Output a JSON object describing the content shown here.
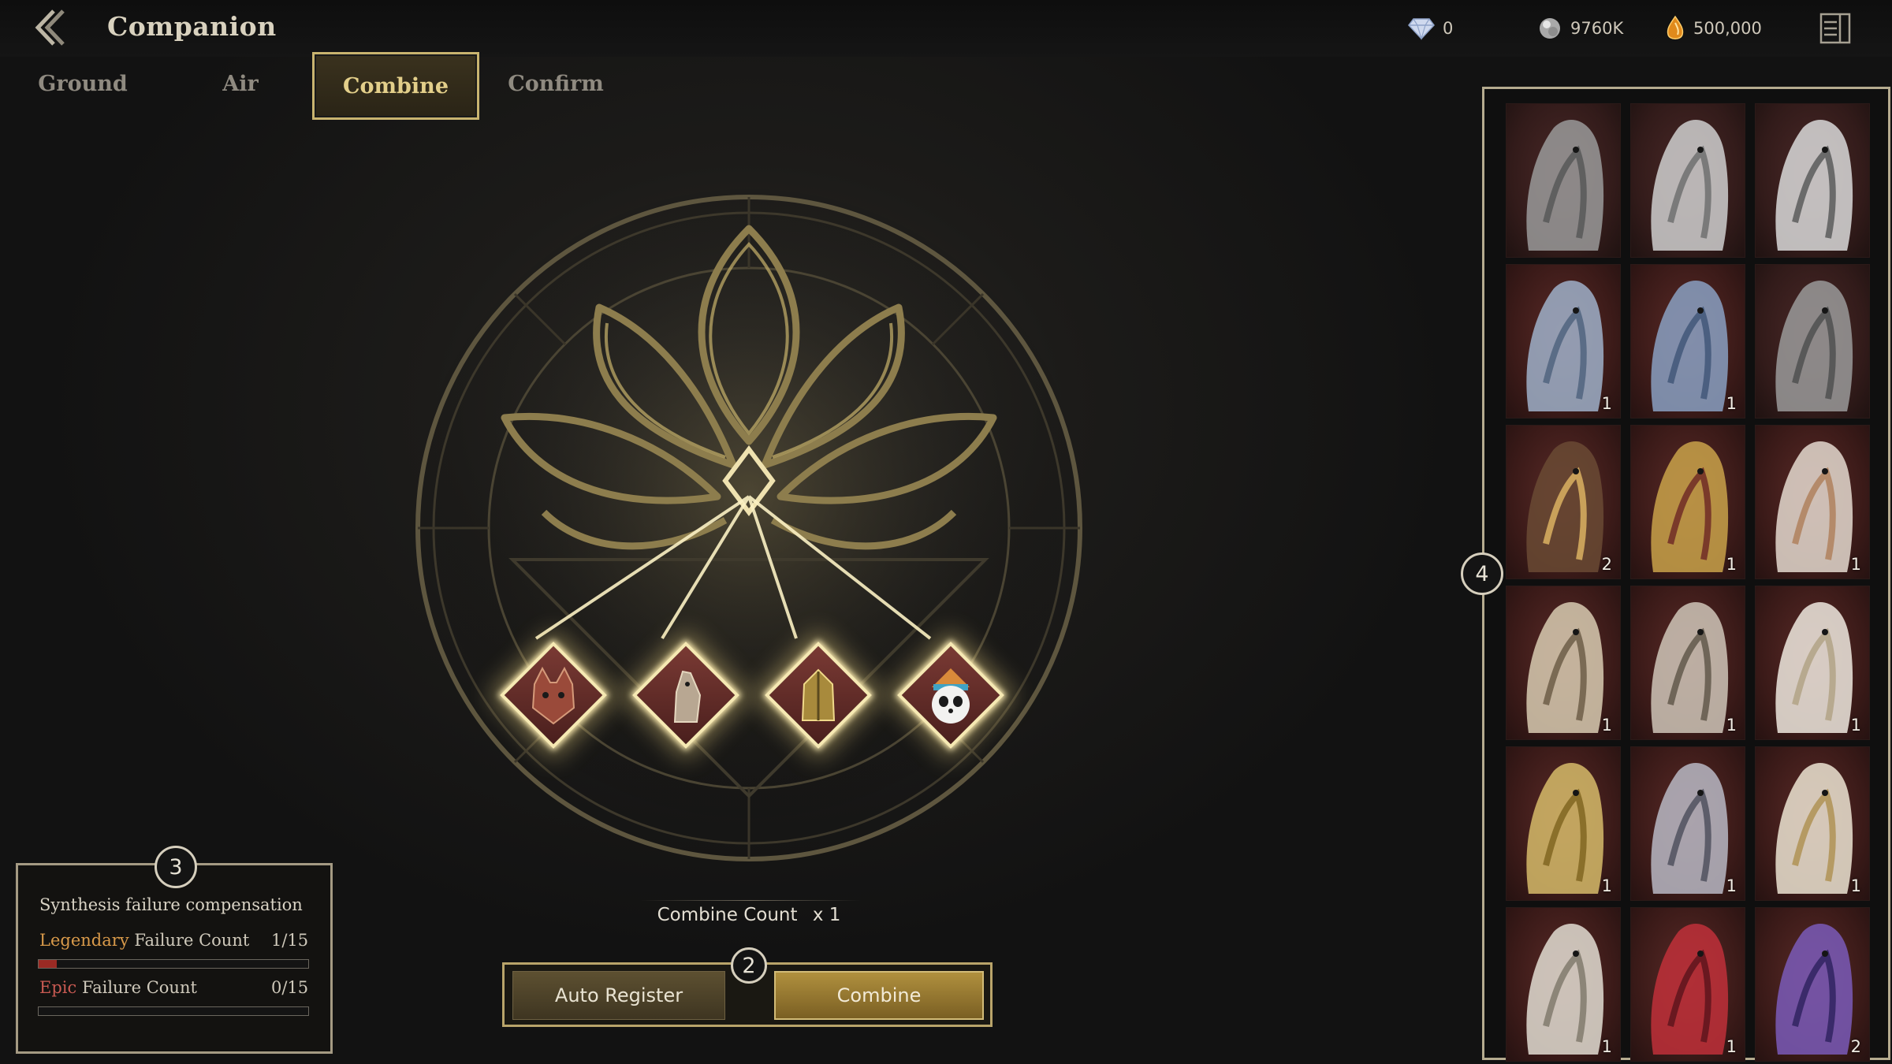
{
  "header": {
    "title": "Companion",
    "currencies": [
      {
        "icon": "diamond-icon",
        "value": "0"
      },
      {
        "icon": "silver-orb-icon",
        "value": "9760K"
      },
      {
        "icon": "amber-gem-icon",
        "value": "500,000"
      }
    ]
  },
  "tabs": [
    {
      "label": "Ground",
      "active": false
    },
    {
      "label": "Air",
      "active": false
    },
    {
      "label": "Combine",
      "active": true
    },
    {
      "label": "Confirm",
      "active": false
    }
  ],
  "combine": {
    "slots": [
      {
        "icon": "wolf-portrait-icon"
      },
      {
        "icon": "horse-portrait-icon"
      },
      {
        "icon": "armored-beast-portrait-icon"
      },
      {
        "icon": "panda-portrait-icon"
      }
    ],
    "count_label": "Combine Count",
    "count_value": "x 1",
    "auto_register_label": "Auto Register",
    "combine_label": "Combine"
  },
  "badges": {
    "buttons": "2",
    "failure": "3",
    "inventory": "4"
  },
  "failure_panel": {
    "title": "Synthesis failure compensation",
    "rows": [
      {
        "rarity": "Legendary",
        "label": "Failure Count",
        "value": "1/15",
        "progress": 0.067
      },
      {
        "rarity": "Epic",
        "label": "Failure Count",
        "value": "0/15",
        "progress": 0
      }
    ]
  },
  "inventory": [
    {
      "name": "armored-beast",
      "qty": "",
      "tone": "grey"
    },
    {
      "name": "white-horse",
      "qty": "",
      "tone": "grey"
    },
    {
      "name": "panda",
      "qty": "",
      "tone": "grey"
    },
    {
      "name": "armored-war-beast",
      "qty": "1",
      "tone": "color"
    },
    {
      "name": "blue-wolf",
      "qty": "1",
      "tone": "color"
    },
    {
      "name": "grey-wolf",
      "qty": "",
      "tone": "grey"
    },
    {
      "name": "dark-horse",
      "qty": "2",
      "tone": "color"
    },
    {
      "name": "golden-dragon-steed",
      "qty": "1",
      "tone": "color"
    },
    {
      "name": "white-griffin",
      "qty": "1",
      "tone": "color"
    },
    {
      "name": "owl-griffin",
      "qty": "1",
      "tone": "color"
    },
    {
      "name": "horned-owl",
      "qty": "1",
      "tone": "color"
    },
    {
      "name": "snow-owl",
      "qty": "1",
      "tone": "color"
    },
    {
      "name": "golden-eagle",
      "qty": "1",
      "tone": "color"
    },
    {
      "name": "grey-hawk",
      "qty": "1",
      "tone": "color"
    },
    {
      "name": "ivory-griffin",
      "qty": "1",
      "tone": "color"
    },
    {
      "name": "silver-eagle",
      "qty": "1",
      "tone": "color"
    },
    {
      "name": "crimson-phoenix",
      "qty": "1",
      "tone": "color"
    },
    {
      "name": "violet-dragon",
      "qty": "2",
      "tone": "color"
    }
  ],
  "colors": {
    "accent_gold": "#c9b46f",
    "legendary": "#d99a4a",
    "epic": "#c95a52"
  }
}
